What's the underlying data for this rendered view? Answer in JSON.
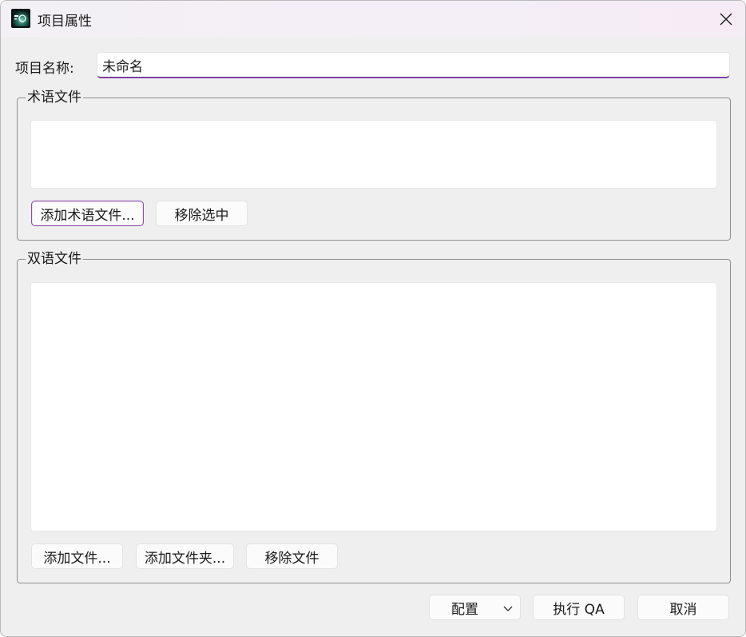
{
  "window": {
    "title": "项目属性"
  },
  "form": {
    "name_label": "项目名称:",
    "name_value": "未命名"
  },
  "term_group": {
    "title": "术语文件",
    "files": [],
    "add_label": "添加术语文件...",
    "remove_label": "移除选中"
  },
  "bilingual_group": {
    "title": "双语文件",
    "files": [],
    "add_file_label": "添加文件...",
    "add_folder_label": "添加文件夹...",
    "remove_label": "移除文件"
  },
  "footer": {
    "config_label": "配置",
    "run_label": "执行 QA",
    "cancel_label": "取消"
  },
  "colors": {
    "accent": "#7b3fa0",
    "window_bg": "#efefef"
  },
  "icons": {
    "app": "app-logo-icon",
    "close": "close-icon",
    "combo": "chevron-down-icon"
  }
}
